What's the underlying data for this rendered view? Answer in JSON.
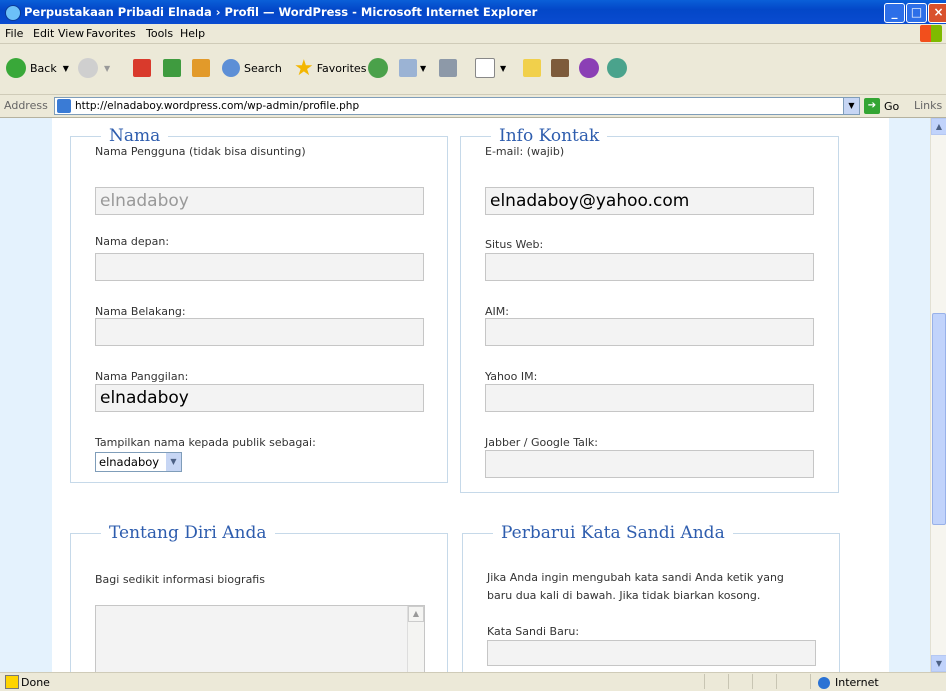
{
  "window": {
    "title": "Perpustakaan Pribadi Elnada › Profil — WordPress - Microsoft Internet Explorer",
    "buttons": {
      "minimize": "_",
      "maximize": "□",
      "close": "×"
    }
  },
  "menu": [
    "File",
    "Edit",
    "View",
    "Favorites",
    "Tools",
    "Help"
  ],
  "toolbar": {
    "back": "Back",
    "search": "Search",
    "favorites": "Favorites"
  },
  "address": {
    "label": "Address",
    "url": "http://elnadaboy.wordpress.com/wp-admin/profile.php",
    "go": "Go",
    "links": "Links"
  },
  "sections": {
    "nama": {
      "legend": "Nama",
      "username_label": "Nama Pengguna (tidak bisa disunting)",
      "username_value": "elnadaboy",
      "first_name_label": "Nama depan:",
      "first_name_value": "",
      "last_name_label": "Nama Belakang:",
      "last_name_value": "",
      "nickname_label": "Nama Panggilan:",
      "nickname_value": "elnadaboy",
      "display_label": "Tampilkan nama kepada publik sebagai:",
      "display_value": "elnadaboy"
    },
    "kontak": {
      "legend": "Info Kontak",
      "email_label": "E-mail: (wajib)",
      "email_value": "elnadaboy@yahoo.com",
      "website_label": "Situs Web:",
      "aim_label": "AIM:",
      "yahoo_label": "Yahoo IM:",
      "jabber_label": "Jabber / Google Talk:"
    },
    "tentang": {
      "legend": "Tentang Diri Anda",
      "bio_label": "Bagi sedikit informasi biografis"
    },
    "password": {
      "legend": "Perbarui Kata Sandi Anda",
      "help_text_1": "Jika Anda ingin mengubah kata sandi Anda ketik yang",
      "help_text_2": "baru dua kali di bawah. Jika tidak biarkan kosong.",
      "new_password_label": "Kata Sandi Baru:"
    }
  },
  "status": {
    "text": "Done",
    "zone": "Internet"
  }
}
